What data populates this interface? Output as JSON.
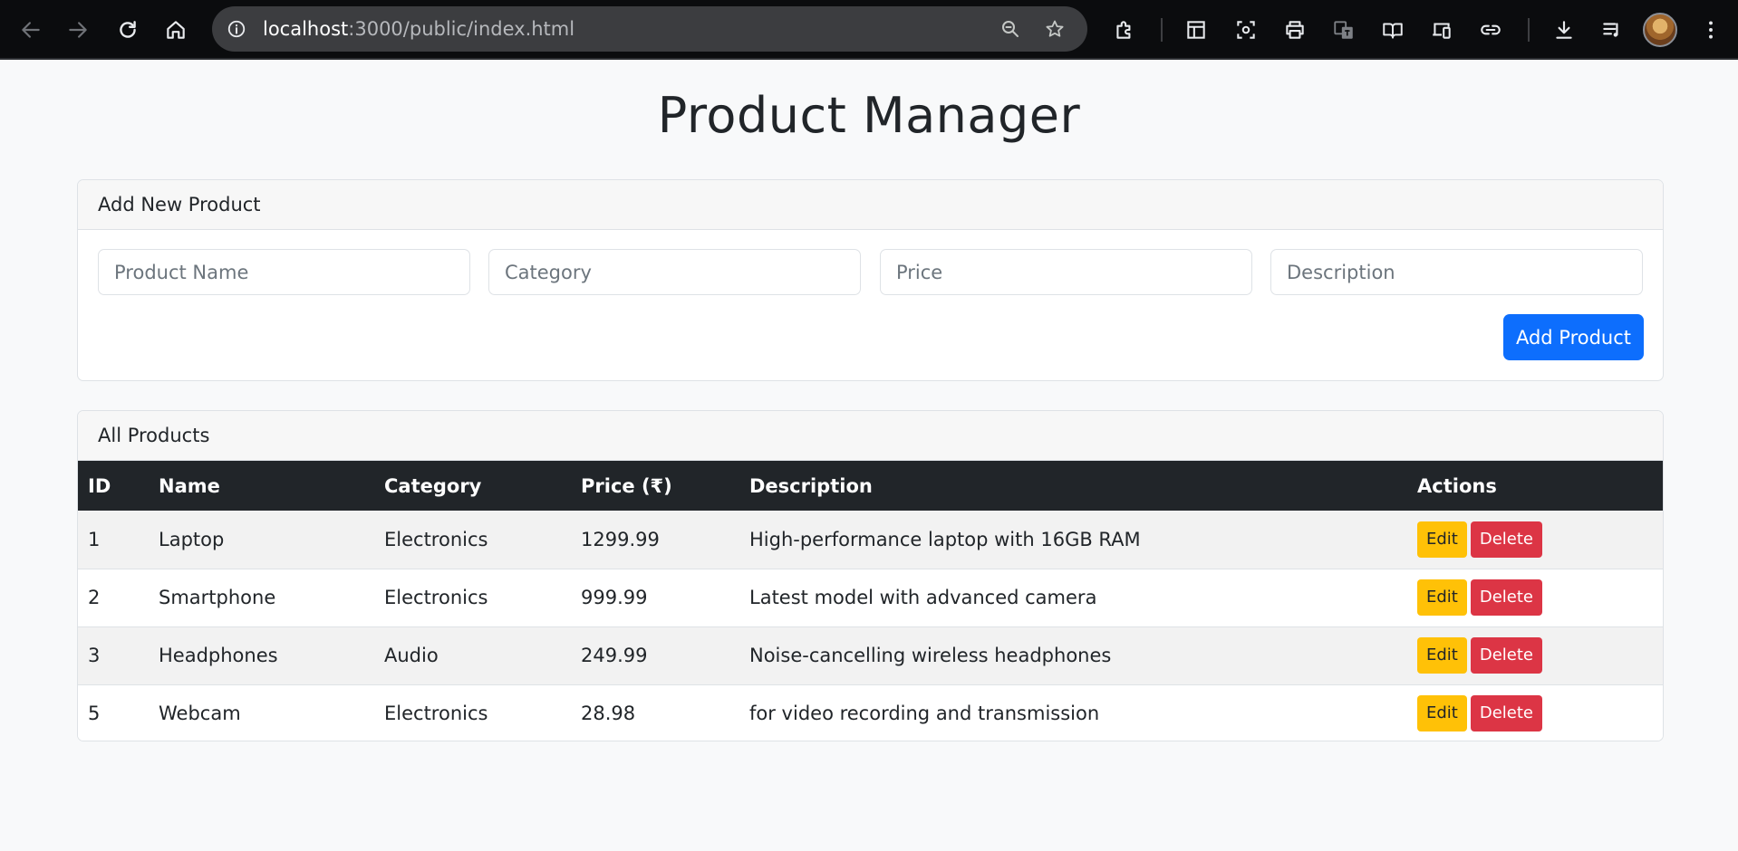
{
  "browser": {
    "url_host": "localhost",
    "url_rest": ":3000/public/index.html"
  },
  "icons": {
    "back": "arrow-left-icon",
    "forward": "arrow-right-icon",
    "reload": "reload-icon",
    "home": "home-icon",
    "site_info": "info-icon",
    "zoom": "zoom-icon",
    "bookmark": "star-icon",
    "extensions": "puzzle-icon",
    "downloads": "download-icon",
    "menu": "kebab-menu-icon"
  },
  "page": {
    "title": "Product Manager"
  },
  "add_form": {
    "header": "Add New Product",
    "name_placeholder": "Product Name",
    "category_placeholder": "Category",
    "price_placeholder": "Price",
    "description_placeholder": "Description",
    "submit_label": "Add Product"
  },
  "products": {
    "header": "All Products",
    "columns": [
      "ID",
      "Name",
      "Category",
      "Price (₹)",
      "Description",
      "Actions"
    ],
    "edit_label": "Edit",
    "delete_label": "Delete",
    "rows": [
      {
        "id": "1",
        "name": "Laptop",
        "category": "Electronics",
        "price": "1299.99",
        "description": "High-performance laptop with 16GB RAM"
      },
      {
        "id": "2",
        "name": "Smartphone",
        "category": "Electronics",
        "price": "999.99",
        "description": "Latest model with advanced camera"
      },
      {
        "id": "3",
        "name": "Headphones",
        "category": "Audio",
        "price": "249.99",
        "description": "Noise-cancelling wireless headphones"
      },
      {
        "id": "5",
        "name": "Webcam",
        "category": "Electronics",
        "price": "28.98",
        "description": "for video recording and transmission"
      }
    ]
  },
  "colors": {
    "primary": "#0d6efd",
    "warning": "#ffc107",
    "danger": "#dc3545",
    "table_header": "#212529"
  }
}
